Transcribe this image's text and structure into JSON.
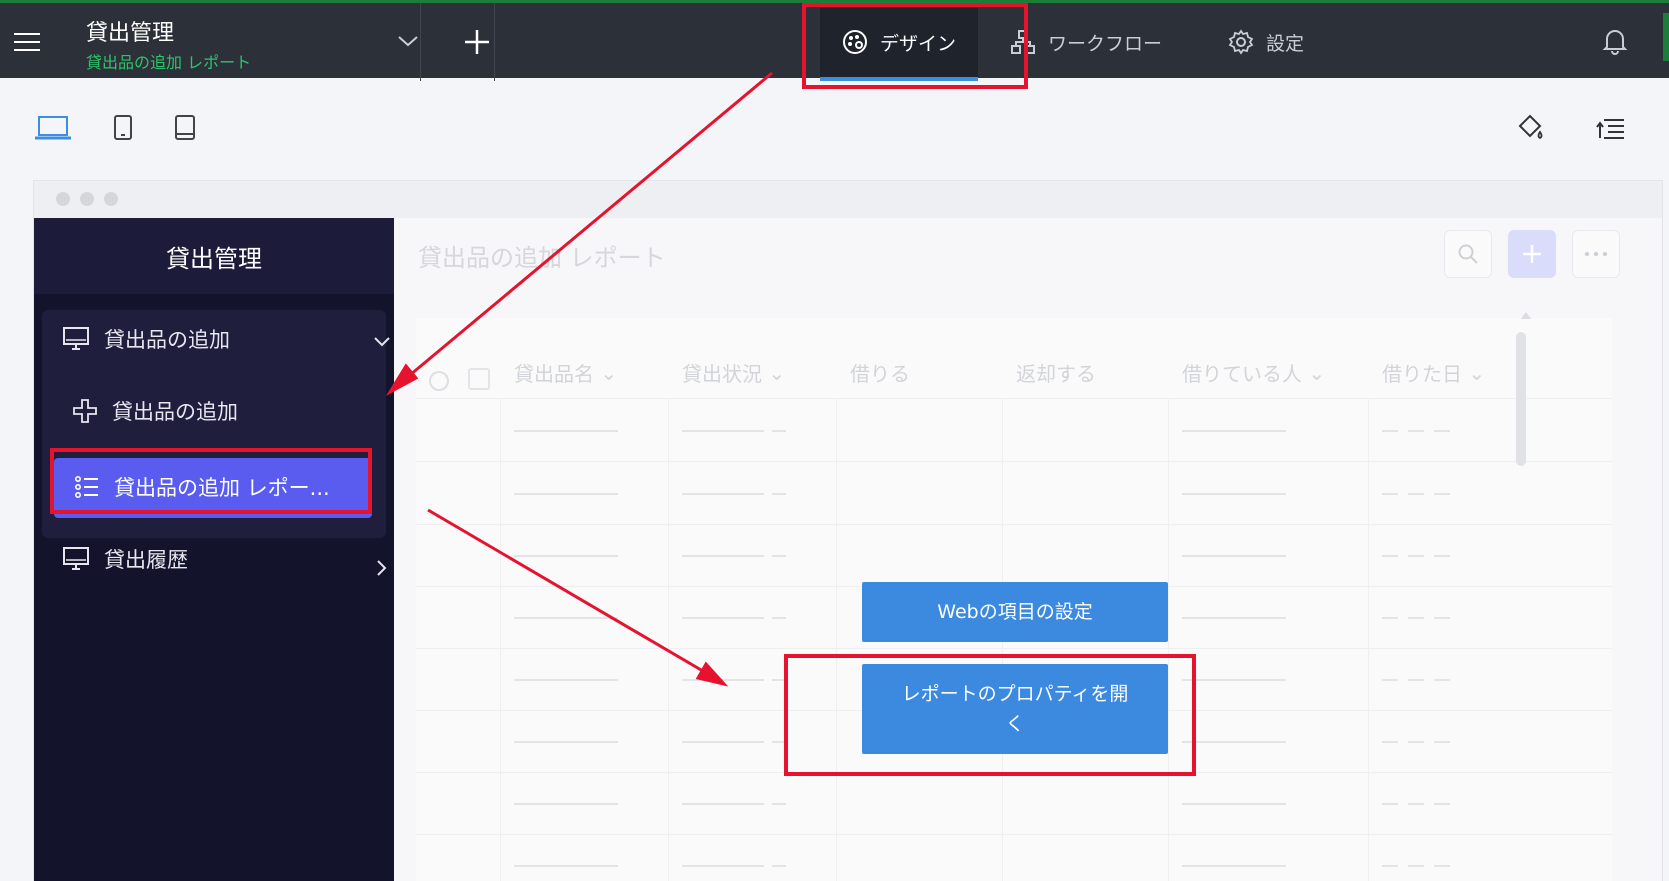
{
  "app": {
    "title": "貸出管理",
    "subtitle": "貸出品の追加 レポート"
  },
  "tabs": [
    {
      "label": "デザイン",
      "icon": "palette-icon",
      "active": true
    },
    {
      "label": "ワークフロー",
      "icon": "workflow-icon",
      "active": false
    },
    {
      "label": "設定",
      "icon": "gear-icon",
      "active": false
    }
  ],
  "devices": [
    "desktop-icon",
    "tablet-icon",
    "mobile-icon"
  ],
  "sidebar": {
    "title": "貸出管理",
    "groups": [
      {
        "label": "貸出品の追加",
        "icon": "monitor-icon",
        "expanded": true
      },
      {
        "label": "貸出履歴",
        "icon": "monitor-icon",
        "expanded": false
      }
    ],
    "items": [
      {
        "label": "貸出品の追加",
        "icon": "plus-icon"
      },
      {
        "label": "貸出品の追加 レポー...",
        "icon": "list-icon",
        "active": true
      }
    ]
  },
  "report": {
    "title": "貸出品の追加 レポート",
    "columns": [
      "貸出品名",
      "貸出状況",
      "借りる",
      "返却する",
      "借りている人",
      "借りた日"
    ]
  },
  "overlay": {
    "web_settings_label": "Webの項目の設定",
    "open_props_line1": "レポートのプロパティを開",
    "open_props_line2": "く"
  },
  "colors": {
    "topbar": "#2b3039",
    "accent_green": "#2fc36b",
    "sidebar": "#14132c",
    "active_item": "#5a5cf0",
    "button_blue": "#3b8ae0",
    "annotation_red": "#e5132e"
  }
}
